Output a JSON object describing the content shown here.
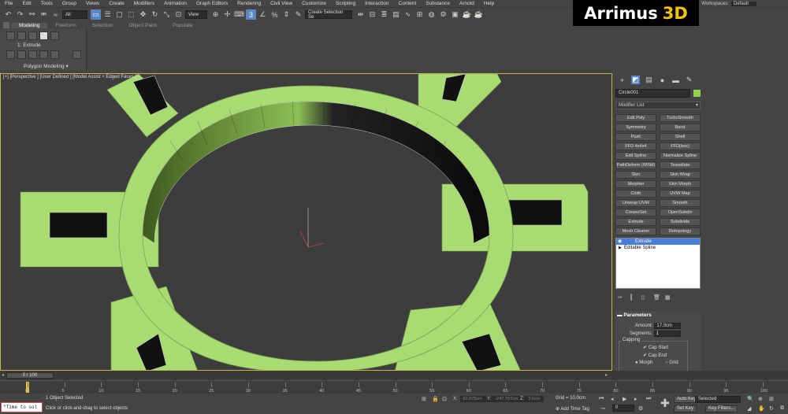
{
  "menu": [
    "File",
    "Edit",
    "Tools",
    "Group",
    "Views",
    "Create",
    "Modifiers",
    "Animation",
    "Graph Editors",
    "Rendering",
    "Civil View",
    "Customize",
    "Scripting",
    "Interaction",
    "Content",
    "Substance",
    "Arnold",
    "Help"
  ],
  "workspaces": {
    "label": "Workspaces:",
    "value": "Default"
  },
  "toolbar": {
    "filter": "All",
    "object_name": "Circle001",
    "view_dropdown": "View",
    "selection_set": "Create Selection Se"
  },
  "logo": {
    "main": "Arrimus",
    "accent": "3D"
  },
  "ribbon": {
    "tabs": [
      "Modeling",
      "Freeform",
      "Selection",
      "Object Paint",
      "Populate"
    ],
    "active_tab": "Modeling",
    "current_modifier": "1: Extrude",
    "group_label": "Polygon Modeling"
  },
  "viewport": {
    "label": "[+] [Perspective ] [User Defined ] [Model Assist + Edged Faces ]",
    "object_color": "#a8dc73",
    "border_color": "#c9b04a"
  },
  "command_panel": {
    "object_name": "Circle001",
    "object_color": "#8fd24e",
    "modifier_list": "Modifier List",
    "modifier_buttons": [
      "Edit Poly",
      "TurboSmooth",
      "Symmetry",
      "Bend",
      "Push",
      "Shell",
      "FFD 4x4x4",
      "FFD(box)",
      "Edit Spline",
      "Normalize Spline",
      "PathDeform (WSM)",
      "Tessellate",
      "Skin",
      "Skin Wrap",
      "Morpher",
      "Skin Morph",
      "Cloth",
      "UVW Map",
      "Unwrap UVW",
      "Smooth",
      "CreaseSet",
      "OpenSubdiv",
      "Extrude",
      "Subdivide",
      "Mesh Cleaner",
      "Retopology"
    ],
    "stack": [
      {
        "name": "Extrude",
        "selected": true
      },
      {
        "name": "Editable Spline",
        "selected": false
      }
    ],
    "parameters": {
      "title": "Parameters",
      "amount_label": "Amount:",
      "amount_value": "17.0cm",
      "segments_label": "Segments:",
      "segments_value": "1",
      "capping_label": "Capping",
      "cap_start": "Cap Start",
      "cap_end": "Cap End",
      "morph": "Morph",
      "grid": "Grid"
    }
  },
  "timeline": {
    "frame_display": "0 / 100",
    "ticks": [
      "0",
      "5",
      "10",
      "15",
      "20",
      "25",
      "30",
      "35",
      "40",
      "45",
      "50",
      "55",
      "60",
      "65",
      "70",
      "75",
      "80",
      "85",
      "90",
      "95",
      "100"
    ],
    "ticks_right": [
      "65",
      "70",
      "75",
      "80",
      "85",
      "90",
      "95",
      "100"
    ]
  },
  "status": {
    "maxscript": "\"Time to sol",
    "line1": "1 Object Selected",
    "line2": "Click or click-and-drag to select objects",
    "x_label": "X:",
    "x_value": "-62.878cm",
    "y_label": "Y:",
    "y_value": "-247.767cm",
    "z_label": "Z:",
    "z_value": "0.0cm",
    "grid": "Grid = 10.0cm",
    "add_time_tag": "Add Time Tag",
    "auto_key": "Auto Key",
    "set_key": "Set Key",
    "selected": "Selected",
    "key_filters": "Key Filters...",
    "frame_field": "0"
  }
}
